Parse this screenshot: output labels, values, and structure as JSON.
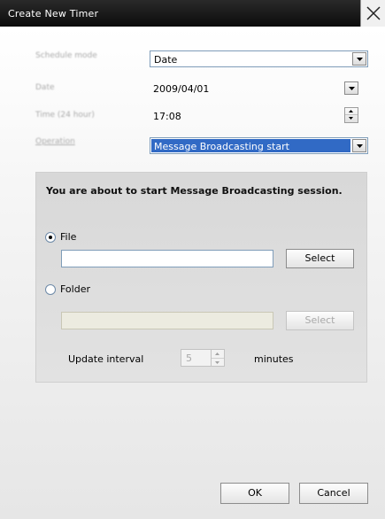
{
  "window": {
    "title": "Create New Timer"
  },
  "form": {
    "schedule_mode": {
      "label": "Schedule mode",
      "value": "Date"
    },
    "date": {
      "label": "Date",
      "value": "2009/04/01"
    },
    "time": {
      "label": "Time (24 hour)",
      "value": "17:08"
    },
    "operation": {
      "label": "Operation",
      "value": "Message Broadcasting start"
    }
  },
  "panel": {
    "heading": "You are about to start Message Broadcasting session.",
    "file": {
      "label": "File",
      "selected": true,
      "path": "",
      "select_label": "Select"
    },
    "folder": {
      "label": "Folder",
      "selected": false,
      "path": "",
      "select_label": "Select"
    },
    "update_interval": {
      "label": "Update interval",
      "value": "5",
      "unit": "minutes"
    }
  },
  "buttons": {
    "ok": "OK",
    "cancel": "Cancel"
  }
}
